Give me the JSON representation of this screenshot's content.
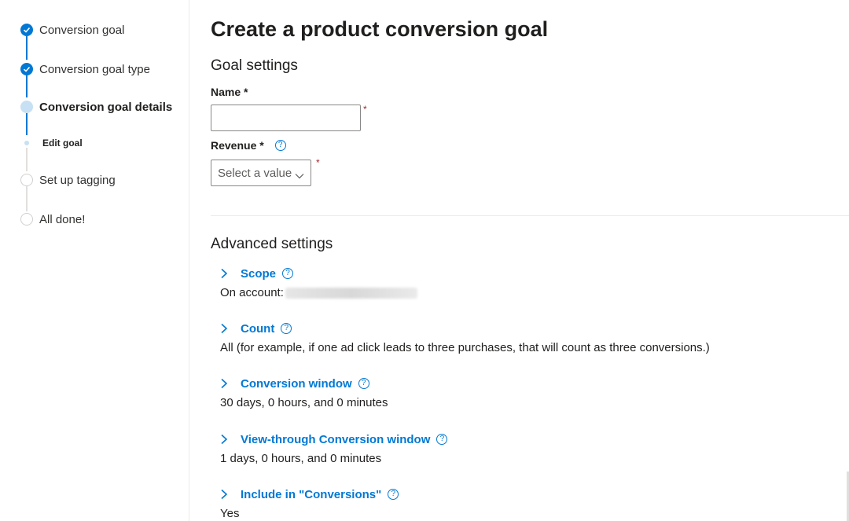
{
  "stepper": {
    "steps": [
      {
        "label": "Conversion goal",
        "state": "done"
      },
      {
        "label": "Conversion goal type",
        "state": "done"
      },
      {
        "label": "Conversion goal details",
        "state": "current"
      },
      {
        "label": "Set up tagging",
        "state": "todo"
      },
      {
        "label": "All done!",
        "state": "todo"
      }
    ],
    "substep": {
      "label": "Edit goal"
    }
  },
  "page": {
    "title": "Create a product conversion goal",
    "goal_settings_title": "Goal settings"
  },
  "form": {
    "name_label": "Name *",
    "name_value": "",
    "revenue_label": "Revenue *",
    "revenue_select_value": "Select a value",
    "required_marker": "*",
    "help_glyph": "?"
  },
  "advanced": {
    "title": "Advanced settings",
    "items": [
      {
        "label": "Scope",
        "value": "On account:"
      },
      {
        "label": "Count",
        "value": "All (for example, if one ad click leads to three purchases, that will count as three conversions.)"
      },
      {
        "label": "Conversion window",
        "value": "30 days, 0 hours, and 0 minutes"
      },
      {
        "label": "View-through Conversion window",
        "value": "1 days, 0 hours, and 0 minutes"
      },
      {
        "label": "Include in \"Conversions\"",
        "value": "Yes"
      }
    ]
  },
  "colors": {
    "accent": "#0078d4",
    "current_step": "#c7e0f4",
    "required": "#a4262c"
  }
}
